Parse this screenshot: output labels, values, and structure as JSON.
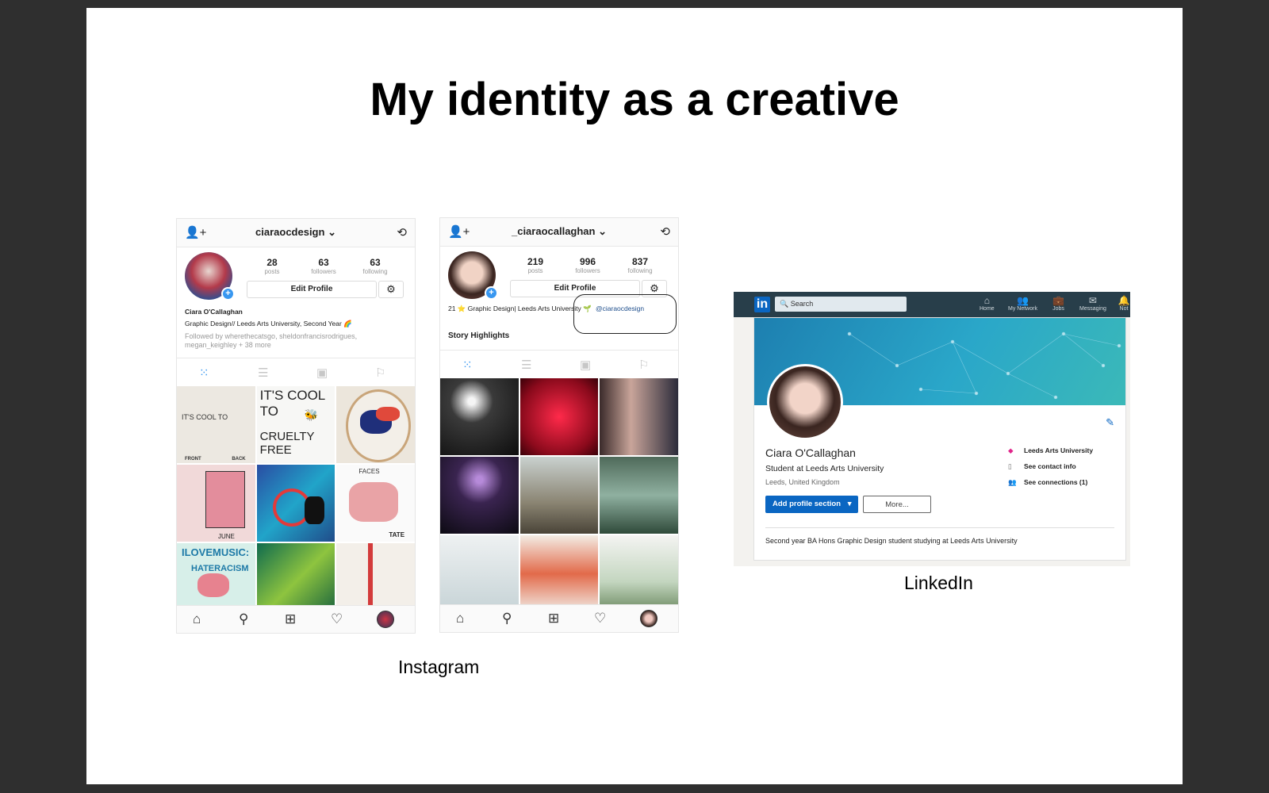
{
  "slide": {
    "title": "My identity as a creative",
    "caption_instagram": "Instagram",
    "caption_linkedin": "LinkedIn"
  },
  "instagram_1": {
    "username": "ciaraocdesign",
    "posts": "28",
    "posts_label": "posts",
    "followers": "63",
    "followers_label": "followers",
    "following": "63",
    "following_label": "following",
    "edit_profile": "Edit Profile",
    "name": "Ciara O'Callaghan",
    "bio": "Graphic Design// Leeds Arts University, Second Year 🌈",
    "followed_by_1": "Followed by wherethecatsgo, sheldonfrancisrodrigues,",
    "followed_by_2": "megan_keighley + 38 more",
    "post_texts": [
      "IT'S COOL TO",
      "CRUELTY FREE",
      "FRONT",
      "BACK",
      "JUNE",
      "FACES",
      "TATE",
      "ILOVEMUSIC:",
      "HATERACISM"
    ]
  },
  "instagram_2": {
    "username": "_ciaraocallaghan",
    "posts": "219",
    "posts_label": "posts",
    "followers": "996",
    "followers_label": "followers",
    "following": "837",
    "following_label": "following",
    "edit_profile": "Edit Profile",
    "bio": "21 ⭐ Graphic Design| Leeds Arts University 🌱",
    "bio_link": "@ciaraocdesign",
    "story_highlights": "Story Highlights"
  },
  "linkedin": {
    "search_placeholder": "Search",
    "nav": [
      "Home",
      "My Network",
      "Jobs",
      "Messaging",
      "Not"
    ],
    "name": "Ciara O'Callaghan",
    "headline": "Student at Leeds Arts University",
    "location": "Leeds, United Kingdom",
    "add_profile_section": "Add profile section",
    "more": "More...",
    "school": "Leeds Arts University",
    "contact": "See contact info",
    "connections": "See connections (1)",
    "summary": "Second year BA Hons Graphic Design student studying at Leeds Arts University"
  },
  "colors": {
    "instagram_blue": "#3897f0",
    "linkedin_nav": "#283e4a",
    "linkedin_blue": "#0a66c2"
  }
}
